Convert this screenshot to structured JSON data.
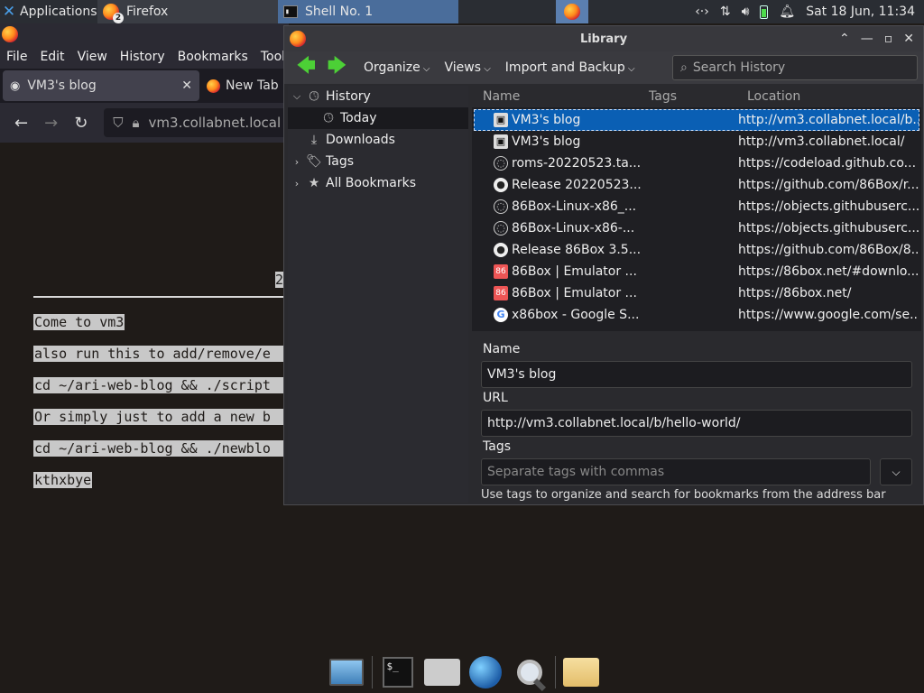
{
  "top_panel": {
    "applications": "Applications",
    "firefox_task": "Firefox",
    "firefox_badge": "2",
    "shell_task": "Shell No. 1",
    "datetime": "Sat 18 Jun, 11:34"
  },
  "firefox": {
    "menu": [
      "File",
      "Edit",
      "View",
      "History",
      "Bookmarks",
      "Tools"
    ],
    "tab_active": "VM3's blog",
    "tab_new": "New Tab",
    "url": "vm3.collabnet.local",
    "content_lines": [
      "Come to vm3",
      "also run this to add/remove/e",
      "cd ~/ari-web-blog && ./script",
      "Or simply just to add a new b",
      "cd ~/ari-web-blog && ./newblo",
      "kthxbye"
    ],
    "content_fragment": "2"
  },
  "library": {
    "title": "Library",
    "toolbar": {
      "organize": "Organize",
      "views": "Views",
      "import_backup": "Import and Backup",
      "search_placeholder": "Search History"
    },
    "tree": {
      "history": "History",
      "today": "Today",
      "downloads": "Downloads",
      "tags": "Tags",
      "all_bookmarks": "All Bookmarks"
    },
    "columns": {
      "name": "Name",
      "tags": "Tags",
      "location": "Location"
    },
    "rows": [
      {
        "name": "VM3's blog",
        "location": "http://vm3.collabnet.local/b...",
        "icon": "vm-icon"
      },
      {
        "name": "VM3's blog",
        "location": "http://vm3.collabnet.local/",
        "icon": "vm-icon"
      },
      {
        "name": "roms-20220523.ta...",
        "location": "https://codeload.github.co...",
        "icon": "globe-icon"
      },
      {
        "name": "Release 20220523...",
        "location": "https://github.com/86Box/r...",
        "icon": "github-icon"
      },
      {
        "name": "86Box-Linux-x86_...",
        "location": "https://objects.githubuserc...",
        "icon": "globe-icon"
      },
      {
        "name": "86Box-Linux-x86-...",
        "location": "https://objects.githubuserc...",
        "icon": "globe-icon"
      },
      {
        "name": "Release 86Box 3.5...",
        "location": "https://github.com/86Box/8...",
        "icon": "github-icon"
      },
      {
        "name": "86Box | Emulator ...",
        "location": "https://86box.net/#downlo...",
        "icon": "86box-icon"
      },
      {
        "name": "86Box | Emulator ...",
        "location": "https://86box.net/",
        "icon": "86box-icon"
      },
      {
        "name": "x86box - Google S...",
        "location": "https://www.google.com/se...",
        "icon": "google-icon"
      }
    ],
    "details": {
      "name_label": "Name",
      "name_value": "VM3's blog",
      "url_label": "URL",
      "url_value": "http://vm3.collabnet.local/b/hello-world/",
      "tags_label": "Tags",
      "tags_placeholder": "Separate tags with commas",
      "hint": "Use tags to organize and search for bookmarks from the address bar"
    }
  },
  "dock": {
    "terminal_glyph": "$_"
  }
}
